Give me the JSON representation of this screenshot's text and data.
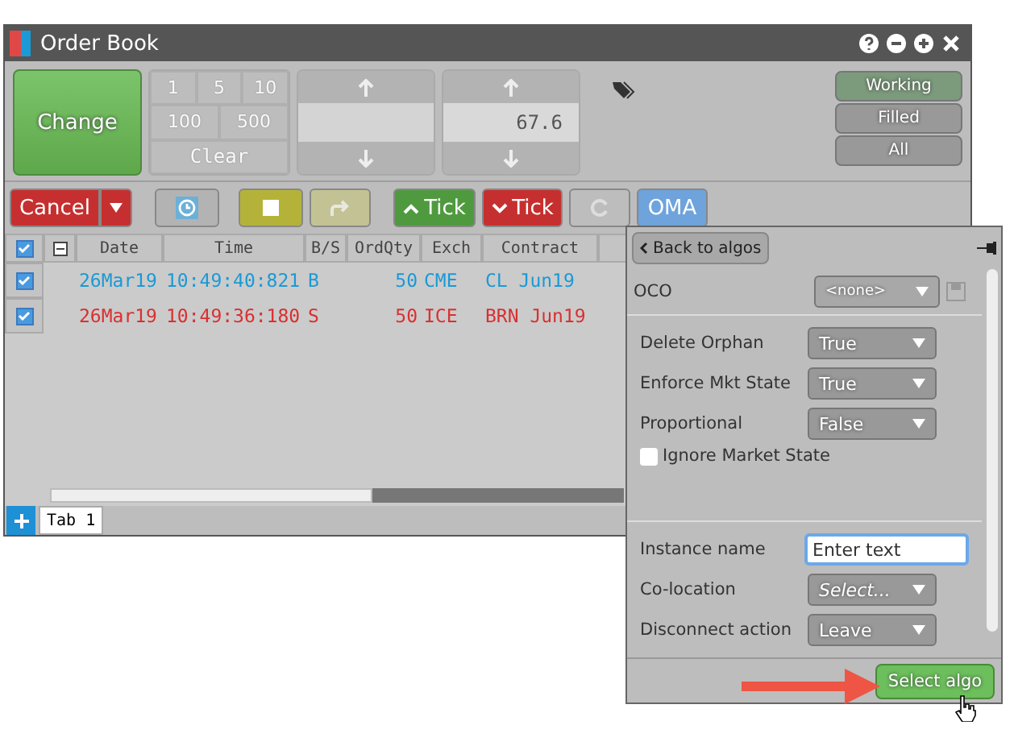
{
  "window": {
    "title": "Order Book"
  },
  "order_entry": {
    "action": "Change",
    "quantities": [
      "1",
      "5",
      "10",
      "100",
      "500"
    ],
    "clear": "Clear",
    "price_fields": [
      {
        "kind": "blank"
      },
      {
        "kind": "value",
        "value": "67.6"
      }
    ]
  },
  "filters": [
    {
      "label": "Working",
      "selected": true
    },
    {
      "label": "Filled",
      "selected": false
    },
    {
      "label": "All",
      "selected": false
    }
  ],
  "toolbar": {
    "cancel": "Cancel",
    "tick_up": "Tick",
    "tick_down": "Tick",
    "oma": "OMA"
  },
  "table": {
    "all_checked": true,
    "columns": [
      "Date",
      "Time",
      "B/S",
      "OrdQty",
      "Exch",
      "Contract"
    ],
    "rows": [
      {
        "checked": true,
        "kind": "buy",
        "cells": [
          "26Mar19",
          "10:49:40:821",
          "B",
          "50",
          "CME",
          "CL Jun19"
        ]
      },
      {
        "checked": true,
        "kind": "sell",
        "cells": [
          "26Mar19",
          "10:49:36:180",
          "S",
          "50",
          "ICE",
          "BRN Jun19"
        ]
      }
    ]
  },
  "tabs": [
    {
      "label": "Tab 1",
      "selected": true
    }
  ],
  "algo_panel": {
    "back": "Back to algos",
    "oco": {
      "label": "OCO",
      "value": "<none>"
    },
    "params": [
      {
        "label": "Delete Orphan",
        "value": "True"
      },
      {
        "label": "Enforce Mkt State",
        "value": "True"
      },
      {
        "label": "Proportional",
        "value": "False"
      }
    ],
    "checkbox": {
      "label": "Ignore Market State",
      "checked": false
    },
    "instance": {
      "label": "Instance name",
      "placeholder": "Enter text"
    },
    "more": [
      {
        "label": "Co-location",
        "value": "Select...",
        "italic": true
      },
      {
        "label": "Disconnect action",
        "value": "Leave",
        "italic": false
      }
    ],
    "submit": "Select algo"
  }
}
